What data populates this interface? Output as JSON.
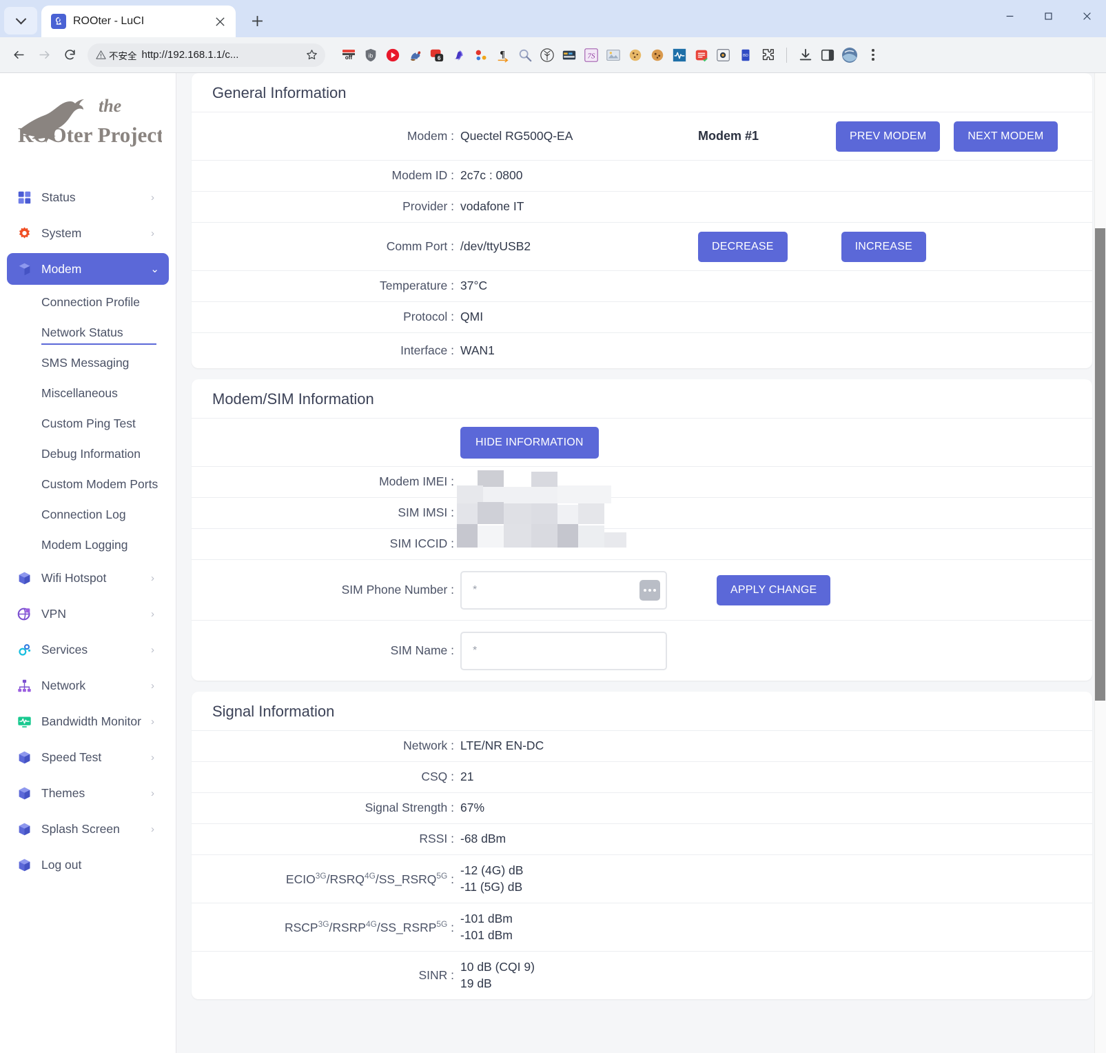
{
  "browser": {
    "tab_title": "ROOter - LuCI",
    "new_tab_label": "+",
    "security_label": "不安全",
    "url": "http://192.168.1.1/c...",
    "window": {
      "minimize": "—",
      "maximize": "□",
      "close": "✕"
    },
    "extensions": [
      {
        "name": "toggle-off-extension-icon",
        "glyph": "off"
      },
      {
        "name": "shield-extension-icon",
        "glyph": "ib"
      },
      {
        "name": "video-play-extension-icon",
        "glyph": "▶"
      },
      {
        "name": "squirrel-extension-icon",
        "glyph": "🐿"
      },
      {
        "name": "badge-6-extension-icon",
        "glyph": "6"
      },
      {
        "name": "wave-extension-icon",
        "glyph": "§"
      },
      {
        "name": "molecule-extension-icon",
        "glyph": "⁖"
      },
      {
        "name": "pilcrow-extension-icon",
        "glyph": "¶"
      },
      {
        "name": "magnifier-extension-icon",
        "glyph": "🔍"
      },
      {
        "name": "tree-circle-extension-icon",
        "glyph": "❋"
      },
      {
        "name": "card-extension-icon",
        "glyph": "▤"
      },
      {
        "name": "seven-s-extension-icon",
        "glyph": "7S"
      },
      {
        "name": "image-extension-icon",
        "glyph": "▣"
      },
      {
        "name": "cookie-extension-icon",
        "glyph": "🍪"
      },
      {
        "name": "cookie-two-extension-icon",
        "glyph": "🍪"
      },
      {
        "name": "pulse-extension-icon",
        "glyph": "∿"
      },
      {
        "name": "notes-extension-icon",
        "glyph": "▤"
      },
      {
        "name": "screenshot-extension-icon",
        "glyph": "◎"
      },
      {
        "name": "blue-doc-extension-icon",
        "glyph": "▮"
      },
      {
        "name": "puzzle-extensions-icon",
        "glyph": "⬠"
      }
    ],
    "downloads_icon": "download-icon",
    "sidepanel_icon": "side-panel-icon",
    "profile_icon": "profile-avatar-icon",
    "menu_icon": "browser-menu-icon"
  },
  "sidebar": {
    "logo_line1": "the",
    "logo_line2": "ROOter Project",
    "items": [
      {
        "label": "Status",
        "icon": "grid-icon",
        "arrow": "›",
        "active": false
      },
      {
        "label": "System",
        "icon": "gear-icon",
        "arrow": "›",
        "active": false
      },
      {
        "label": "Modem",
        "icon": "box-icon",
        "arrow": "⌄",
        "active": true
      },
      {
        "label": "Wifi Hotspot",
        "icon": "box-icon",
        "arrow": "›",
        "active": false
      },
      {
        "label": "VPN",
        "icon": "globe-lock-icon",
        "arrow": "›",
        "active": false
      },
      {
        "label": "Services",
        "icon": "gears-icon",
        "arrow": "›",
        "active": false
      },
      {
        "label": "Network",
        "icon": "sitemap-icon",
        "arrow": "›",
        "active": false
      },
      {
        "label": "Bandwidth Monitor",
        "icon": "monitor-icon",
        "arrow": "›",
        "active": false
      },
      {
        "label": "Speed Test",
        "icon": "box-icon",
        "arrow": "›",
        "active": false
      },
      {
        "label": "Themes",
        "icon": "box-icon",
        "arrow": "›",
        "active": false
      },
      {
        "label": "Splash Screen",
        "icon": "box-icon",
        "arrow": "›",
        "active": false
      },
      {
        "label": "Log out",
        "icon": "box-icon",
        "arrow": "",
        "active": false
      }
    ],
    "sub_items": [
      {
        "label": "Connection Profile",
        "current": false
      },
      {
        "label": "Network Status",
        "current": true
      },
      {
        "label": "SMS Messaging",
        "current": false
      },
      {
        "label": "Miscellaneous",
        "current": false
      },
      {
        "label": "Custom Ping Test",
        "current": false
      },
      {
        "label": "Debug Information",
        "current": false
      },
      {
        "label": "Custom Modem Ports",
        "current": false
      },
      {
        "label": "Connection Log",
        "current": false
      },
      {
        "label": "Modem Logging",
        "current": false
      }
    ]
  },
  "general": {
    "title": "General Information",
    "modem_label": "Modem :",
    "modem_value": "Quectel RG500Q-EA",
    "modem_number": "Modem #1",
    "prev_button": "PREV MODEM",
    "next_button": "NEXT MODEM",
    "modem_id_label": "Modem ID :",
    "modem_id_value": "2c7c : 0800",
    "provider_label": "Provider :",
    "provider_value": "vodafone IT",
    "comm_port_label": "Comm Port :",
    "comm_port_value": "/dev/ttyUSB2",
    "decrease_button": "DECREASE",
    "increase_button": "INCREASE",
    "temperature_label": "Temperature :",
    "temperature_value": "37°C",
    "protocol_label": "Protocol :",
    "protocol_value": "QMI",
    "interface_label": "Interface :",
    "interface_value": "WAN1"
  },
  "sim": {
    "title": "Modem/SIM Information",
    "hide_button": "HIDE INFORMATION",
    "imei_label": "Modem IMEI :",
    "imei_value": "",
    "imsi_label": "SIM IMSI :",
    "imsi_value": "",
    "iccid_label": "SIM ICCID :",
    "iccid_value": "",
    "phone_label": "SIM Phone Number :",
    "phone_placeholder": "*",
    "phone_value": "",
    "apply_button": "APPLY CHANGE",
    "name_label": "SIM Name :",
    "name_placeholder": "*",
    "name_value": ""
  },
  "signal": {
    "title": "Signal Information",
    "network_label": "Network :",
    "network_value": "LTE/NR EN-DC",
    "csq_label": "CSQ :",
    "csq_value": "21",
    "strength_label": "Signal Strength :",
    "strength_value": "67%",
    "rssi_label": "RSSI :",
    "rssi_value": "-68 dBm",
    "ecio_label_parts": [
      "ECIO",
      "3G",
      "/RSRQ",
      "4G",
      "/SS_RSRQ",
      "5G",
      " :"
    ],
    "ecio_value_1": "-12 (4G) dB",
    "ecio_value_2": "-11 (5G) dB",
    "rscp_label_parts": [
      "RSCP",
      "3G",
      "/RSRP",
      "4G",
      "/SS_RSRP",
      "5G",
      " :"
    ],
    "rscp_value_1": "-101 dBm",
    "rscp_value_2": "-101 dBm",
    "sinr_label": "SINR :",
    "sinr_value_1": "10 dB (CQI 9)",
    "sinr_value_2": "19 dB"
  },
  "colors": {
    "accent": "#5b68d8",
    "page_bg": "#f5f6f8",
    "card_bg": "#ffffff",
    "text": "#4b5266",
    "gear_orange": "#f04e23",
    "bandwidth_green": "#18c98f"
  }
}
